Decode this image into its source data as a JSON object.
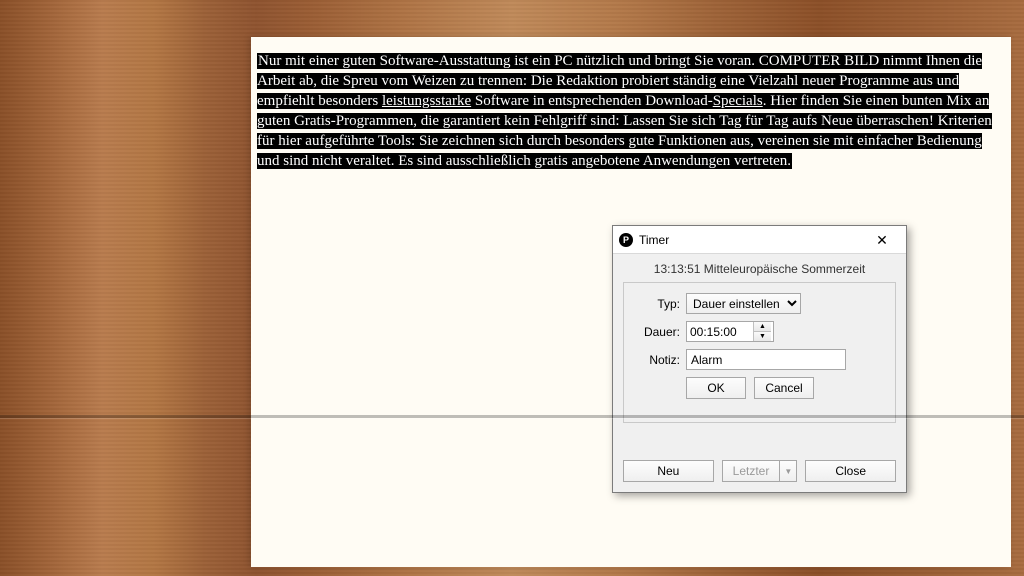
{
  "document": {
    "text_pre_u1": "Nur mit einer guten Software-Ausstattung ist ein PC nützlich und bringt Sie voran. COMPUTER BILD nimmt Ihnen die Arbeit ab, die Spreu vom Weizen zu trennen: Die Redaktion probiert ständig eine Vielzahl neuer Programme aus und empfiehlt besonders ",
    "u1": "leistungsstarke",
    "text_mid": " Software in entsprechenden Download-",
    "u2": "Specials",
    "text_post_u2": ". Hier finden Sie einen bunten Mix an guten Gratis-Programmen, die garantiert kein Fehlgriff sind: Lassen Sie sich Tag für Tag aufs Neue überraschen! Kriterien für hier aufgeführte Tools: Sie zeichnen sich durch besonders gute Funktionen aus, vereinen sie mit einfacher Bedienung und sind nicht veraltet. Es sind ausschließlich gratis angebotene Anwendungen vertreten."
  },
  "dialog": {
    "title": "Timer",
    "app_icon_letter": "P",
    "clock": "13:13:51 Mitteleuropäische Sommerzeit",
    "labels": {
      "type": "Typ:",
      "duration": "Dauer:",
      "note": "Notiz:"
    },
    "type_value": "Dauer einstellen",
    "duration_value": "00:15:00",
    "note_value": "Alarm",
    "buttons": {
      "ok": "OK",
      "cancel": "Cancel",
      "new": "Neu",
      "last": "Letzter",
      "close": "Close"
    }
  }
}
